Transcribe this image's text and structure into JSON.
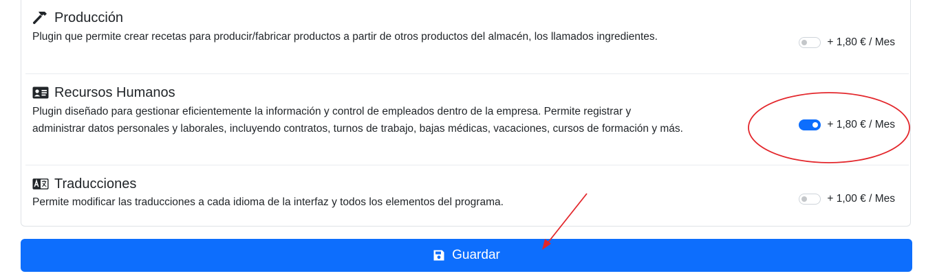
{
  "plugins": [
    {
      "icon": "hammer-icon",
      "name": "Producción",
      "description": "Plugin que permite crear recetas para producir/fabricar productos a partir de otros productos del almacén, los llamados ingredientes.",
      "enabled": false,
      "price": "+ 1,80 € / Mes"
    },
    {
      "icon": "id-card-icon",
      "name": "Recursos Humanos",
      "description": "Plugin diseñado para gestionar eficientemente la información y control de empleados dentro de la empresa. Permite registrar y administrar datos personales y laborales, incluyendo contratos, turnos de trabajo, bajas médicas, vacaciones, cursos de formación y más.",
      "enabled": true,
      "price": "+ 1,80 € / Mes"
    },
    {
      "icon": "translate-icon",
      "name": "Traducciones",
      "description": "Permite modificar las traducciones a cada idioma de la interfaz y todos los elementos del programa.",
      "enabled": false,
      "price": "+ 1,00 € / Mes"
    }
  ],
  "save_button": {
    "label": "Guardar",
    "icon": "save-icon"
  },
  "colors": {
    "primary": "#0d6efd",
    "annotation": "#e3262b"
  }
}
